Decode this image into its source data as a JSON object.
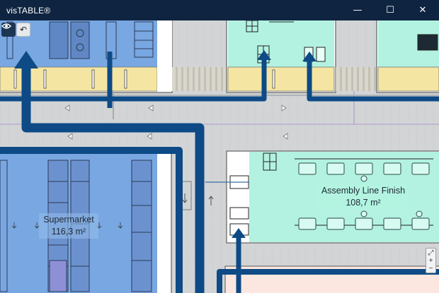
{
  "window": {
    "title": "visTABLE®",
    "minimize_glyph": "—",
    "maximize_glyph": "☐",
    "close_glyph": "✕"
  },
  "toolbar": {
    "view_icon": "eye-icon",
    "undo_icon": "undo-icon",
    "undo_glyph": "↶"
  },
  "areas": {
    "assembly": {
      "name": "Assembly Line Finish",
      "size": "108,7 m²"
    },
    "supermarket": {
      "name": "Supermarket",
      "size": "116,3 m²"
    }
  },
  "zoom": {
    "fit_glyph": "⤢",
    "in_glyph": "+",
    "out_glyph": "−"
  },
  "colors": {
    "titlebar": "#0f2440",
    "flow": "#0d4a86",
    "supermarket": "#7aa9e3",
    "assembly": "#b3f2e0",
    "aisle": "#f5e6a4",
    "floor": "#d2d4d6"
  }
}
